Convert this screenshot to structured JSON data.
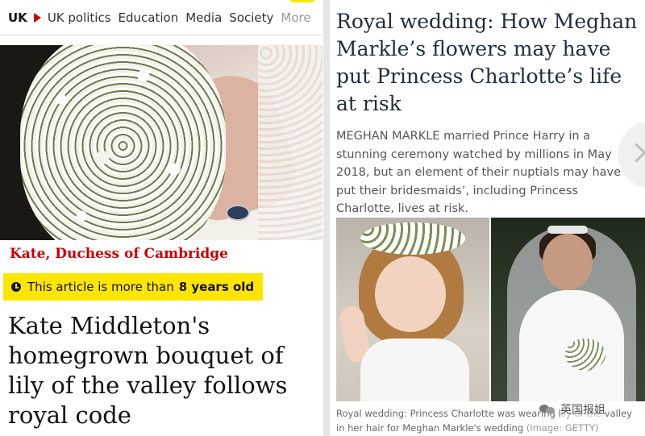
{
  "left_article": {
    "nav": {
      "section": "UK",
      "links": [
        "UK politics",
        "Education",
        "Media",
        "Society",
        "More"
      ]
    },
    "photo": {
      "info_icon": "i"
    },
    "kicker": "Kate, Duchess of Cambridge",
    "notice": {
      "prefix": "This article is more than",
      "age": "8 years old"
    },
    "headline": "Kate Middleton's homegrown bouquet of lily of the valley follows royal code"
  },
  "right_article": {
    "title": "Royal wedding: How Meghan Markle’s flowers may have put Princess Charlotte’s life at risk",
    "lead_name": "MEGHAN MARKLE",
    "lead_rest": "married Prince Harry in a stunning ceremony watched by millions in May 2018, but an element of their nuptials may have put their bridesmaids’, including Princess Charlotte, lives at risk.",
    "caption": "Royal wedding: Princess Charlotte was wearing lily of the valley in her hair for Meghan Markle's wedding",
    "caption_credit": "(Image: GETTY)"
  },
  "watermark": {
    "text": "英国报姐",
    "icon": "wechat-icon"
  },
  "colors": {
    "guardian_red": "#c70000",
    "notice_yellow": "#ffe500",
    "headline": "#121212"
  }
}
